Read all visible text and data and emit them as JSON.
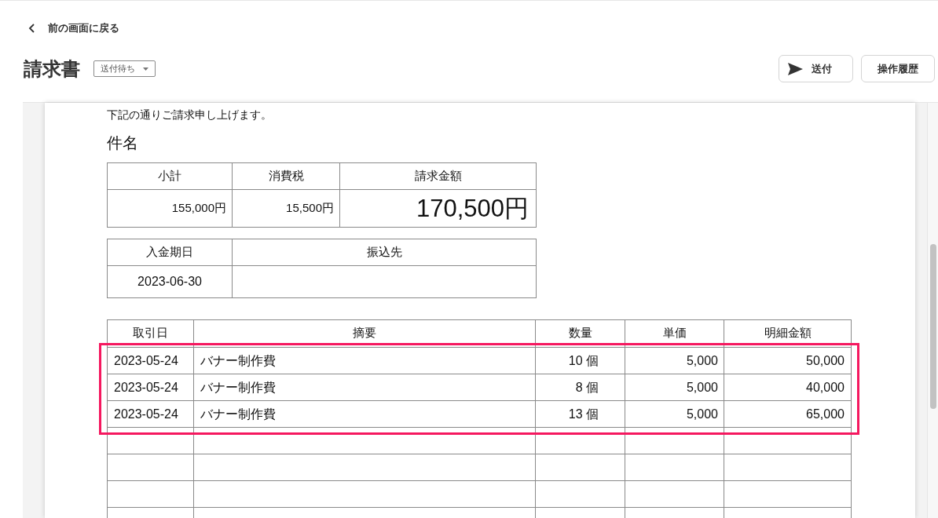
{
  "back_link": {
    "label": "前の画面に戻る"
  },
  "header": {
    "title": "請求書",
    "status": "送付待ち",
    "actions": [
      {
        "kind": "send",
        "label": "送付"
      },
      {
        "kind": "plain",
        "label": "操作履歴"
      }
    ]
  },
  "document": {
    "greeting": "下記の通りご請求申し上げます。",
    "subject_label": "件名",
    "totals": [
      {
        "label": "小計",
        "value": "155,000円",
        "emphasized": false
      },
      {
        "label": "消費税",
        "value": "15,500円",
        "emphasized": false
      },
      {
        "label": "請求金額",
        "value": "170,500円",
        "emphasized": true
      }
    ],
    "payment": {
      "due_date_label": "入金期日",
      "due_date": "2023-06-30",
      "bank_label": "振込先"
    },
    "line_items": {
      "columns": [
        "取引日",
        "摘要",
        "数量",
        "単価",
        "明細金額"
      ],
      "rows": [
        {
          "kind": "item",
          "date": "2023-05-24",
          "description": "バナー制作費",
          "quantity": "10 個",
          "unit_price": "5,000",
          "amount": "50,000",
          "highlighted": true
        },
        {
          "kind": "item",
          "date": "2023-05-24",
          "description": "バナー制作費",
          "quantity": "8 個",
          "unit_price": "5,000",
          "amount": "40,000",
          "highlighted": true
        },
        {
          "kind": "item",
          "date": "2023-05-24",
          "description": "バナー制作費",
          "quantity": "13 個",
          "unit_price": "5,000",
          "amount": "65,000",
          "highlighted": true
        },
        {
          "kind": "blank",
          "highlighted": false
        },
        {
          "kind": "blank",
          "highlighted": false
        },
        {
          "kind": "blank",
          "highlighted": false
        },
        {
          "kind": "blank",
          "highlighted": false
        }
      ]
    }
  }
}
